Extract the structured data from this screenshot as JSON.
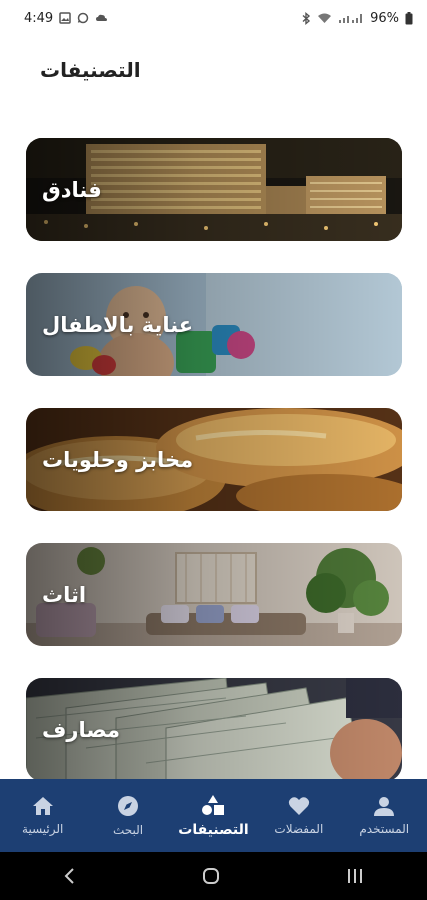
{
  "status_bar": {
    "time": "4:49",
    "battery": "96%"
  },
  "page": {
    "title": "التصنيفات"
  },
  "categories": [
    {
      "label": "فنادق",
      "image": "hotels-photo"
    },
    {
      "label": "عناية بالاطفال",
      "image": "baby-care-photo"
    },
    {
      "label": "مخابز وحلويات",
      "image": "bakery-photo"
    },
    {
      "label": "اثاث",
      "image": "furniture-photo"
    },
    {
      "label": "مصارف",
      "image": "banknotes-photo"
    }
  ],
  "bottom_nav": {
    "items": [
      {
        "label": "الرئيسية",
        "icon": "home-icon",
        "active": false
      },
      {
        "label": "البحث",
        "icon": "compass-icon",
        "active": false
      },
      {
        "label": "التصنيفات",
        "icon": "shapes-icon",
        "active": true
      },
      {
        "label": "المفضلات",
        "icon": "heart-icon",
        "active": false
      },
      {
        "label": "المستخدم",
        "icon": "user-icon",
        "active": false
      }
    ]
  },
  "colors": {
    "nav_bg": "#1d3f73",
    "nav_inactive": "#c9d3e3",
    "nav_active": "#ffffff"
  }
}
